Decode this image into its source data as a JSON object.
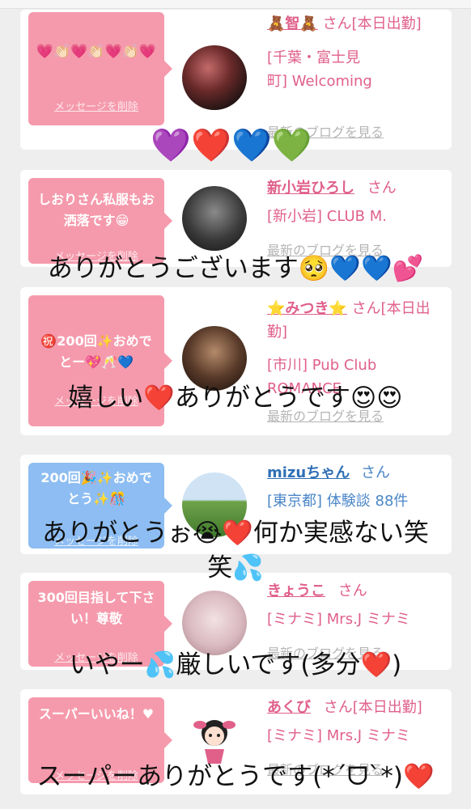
{
  "cards": [
    {
      "message": "💗👏🏻💗👏🏻💗👏🏻💗",
      "delete_label": "メッセージを削除",
      "name": "🧸智🧸",
      "suffix": "さん[本日出勤]",
      "location_line1": "[千葉・富士見",
      "location_line2": "町] Welcoming",
      "blog_label": "最新のブログを見る"
    },
    {
      "message": "しおりさん私服もお洒落です😁",
      "delete_label": "メッセージを削除",
      "name": "新小岩ひろし",
      "suffix": "さん",
      "location_line1": "[新小岩] CLUB M.",
      "blog_label": "最新のブログを見る"
    },
    {
      "message": "㊗️200回✨おめでとー💖🥂💙",
      "delete_label": "メッセージを削除",
      "name": "⭐みつき⭐",
      "suffix": "さん[本日出勤]",
      "location_line1": "[市川] Pub Club",
      "location_line2": "ROMANCE",
      "blog_label": "最新のブログを見る"
    },
    {
      "message": "200回🎉✨おめでとう✨🎊",
      "delete_label": "メッセージを削除",
      "name": "mizuちゃん",
      "suffix": "さん",
      "location_line1": "[東京都] 体験談 88件"
    },
    {
      "message": "300回目指して下さい！尊敬",
      "delete_label": "メッセージを削除",
      "name": "きょうこ",
      "suffix": "さん",
      "location_line1": "[ミナミ] Mrs.J ミナミ",
      "blog_label": "最新のブログを見る"
    },
    {
      "message": "スーパーいいね！♥",
      "delete_label": "メッセージを削除",
      "name": "あくび",
      "suffix": "さん[本日出勤]",
      "location_line1": "[ミナミ] Mrs.J ミナミ",
      "blog_label": "最新のブログを見る"
    }
  ],
  "overlays": {
    "hearts_row": "💜❤️💙💚",
    "line2": "ありがとうございます🥺💙💙💕",
    "line3": "嬉しい❤️ありがとうです😍😍",
    "line4a": "ありがとうぉ😭❤️何か実感ない笑",
    "line4b": "笑💦",
    "line5": "いやー💦厳しいです(多分❤️)",
    "line6": "スーパーありがとうです(*ˊᗜˋ*)❤️"
  },
  "colors": {
    "pink_bubble": "#f59aac",
    "blue_bubble": "#8dbdf2",
    "name_pink": "#e0608a",
    "name_blue": "#4a86c8",
    "link_gray": "#b5b5b5"
  }
}
